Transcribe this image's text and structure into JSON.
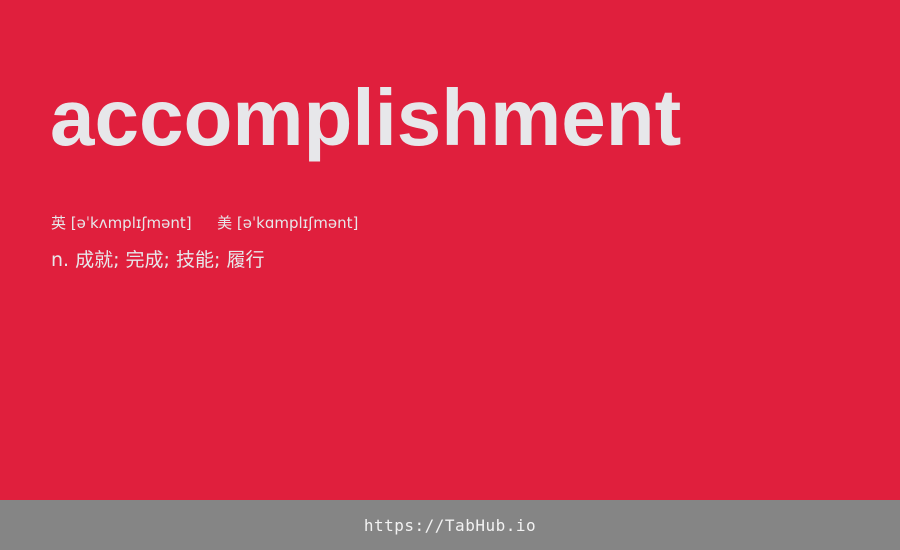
{
  "word": "accomplishment",
  "phonetics": {
    "uk_label": "英",
    "uk_ipa": "[əˈkʌmplɪʃmənt]",
    "us_label": "美",
    "us_ipa": "[əˈkɑmplɪʃmənt]"
  },
  "definition": "n. 成就; 完成; 技能; 履行",
  "footer": {
    "link_text": "https://TabHub.io"
  },
  "colors": {
    "background": "#e01f3d",
    "text": "#e7e7ea",
    "footer_bg": "#858585"
  }
}
